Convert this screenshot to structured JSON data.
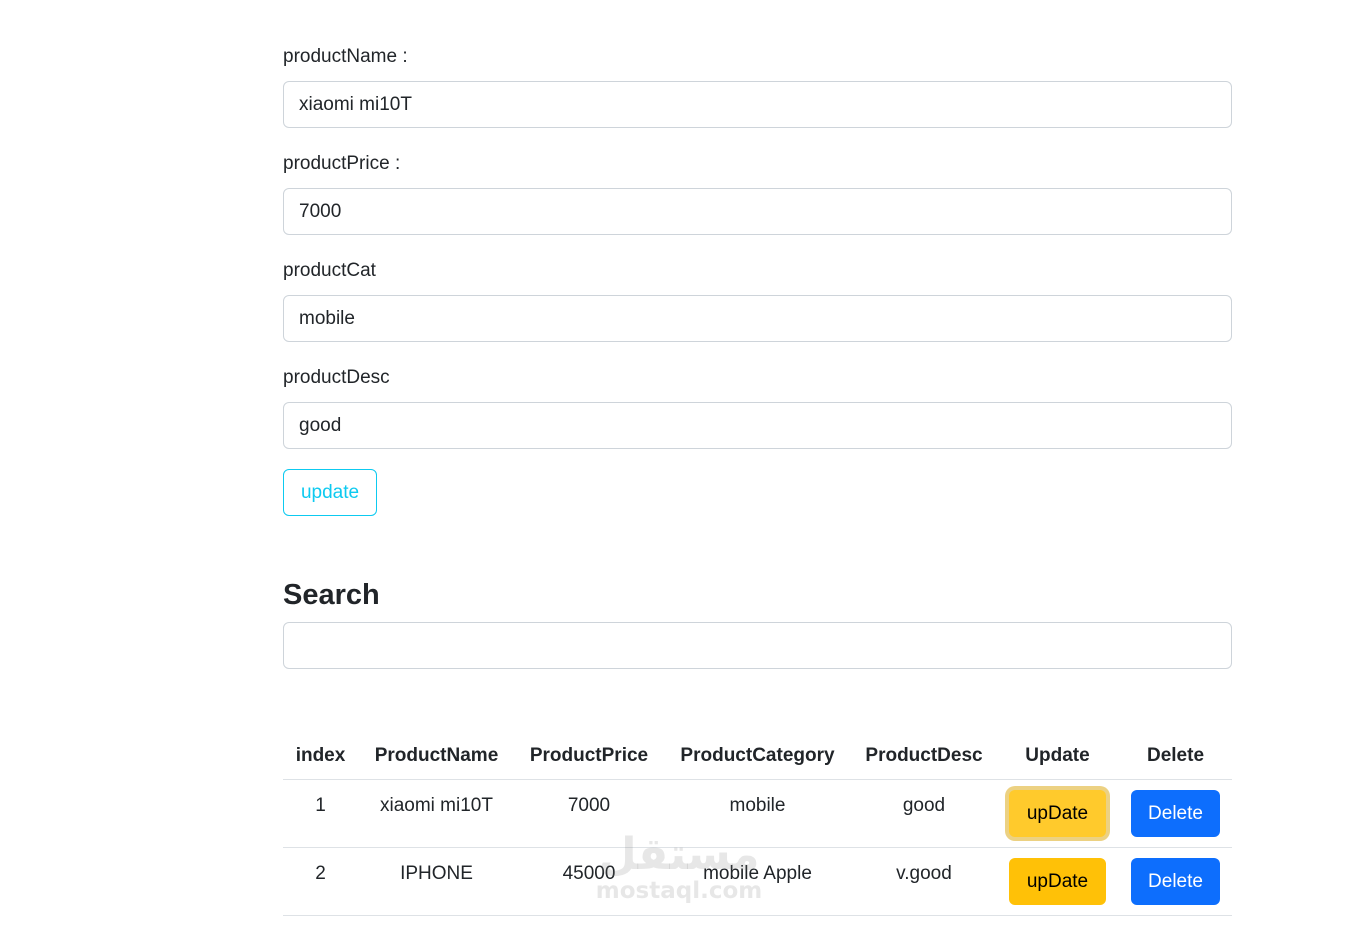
{
  "form": {
    "name_label": "productName :",
    "name_value": "xiaomi mi10T",
    "price_label": "productPrice :",
    "price_value": "7000",
    "cat_label": "productCat",
    "cat_value": "mobile",
    "desc_label": "productDesc",
    "desc_value": "good",
    "update_button": "update"
  },
  "search": {
    "title": "Search",
    "value": ""
  },
  "table": {
    "headers": [
      "index",
      "ProductName",
      "ProductPrice",
      "ProductCategory",
      "ProductDesc",
      "Update",
      "Delete"
    ],
    "rows": [
      {
        "index": "1",
        "name": "xiaomi mi10T",
        "price": "7000",
        "category": "mobile",
        "desc": "good",
        "update_label": "upDate",
        "delete_label": "Delete"
      },
      {
        "index": "2",
        "name": "IPHONE",
        "price": "45000",
        "category": "mobile Apple",
        "desc": "v.good",
        "update_label": "upDate",
        "delete_label": "Delete"
      }
    ]
  },
  "watermark": {
    "arabic": "مستقل",
    "latin": "mostaql.com"
  },
  "colors": {
    "update_outline": "#0dcaf0",
    "row_update": "#ffc107",
    "row_delete": "#0d6efd",
    "border": "#ced4da"
  }
}
